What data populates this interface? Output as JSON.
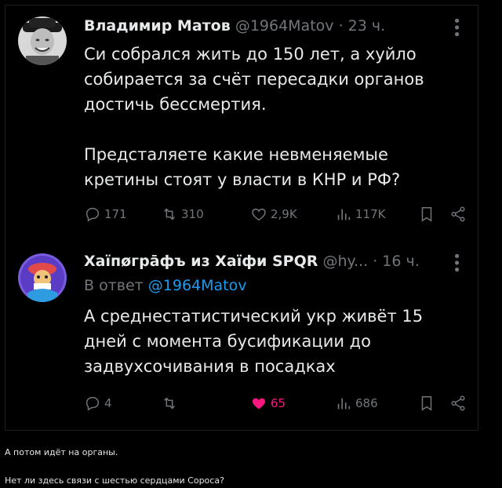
{
  "tweets": [
    {
      "author_name": "Владимир Матов",
      "handle": "@1964Matov",
      "separator": "·",
      "time": "23 ч.",
      "more_icon": "more-vertical-icon",
      "paragraphs": [
        "Си собрался жить до 150 лет, а хуйло собирается за счёт пересадки органов достичь бессмертия.",
        "Предсталяете какие невменяемые кретины стоят у власти в КНР и РФ?"
      ],
      "actions": {
        "replies": "171",
        "reposts": "310",
        "likes": "2,9K",
        "views": "117K"
      },
      "liked": false
    },
    {
      "author_name": "Хаїпøгрāфъ из Хаїфи SPQR",
      "handle": "@hy...",
      "separator": "·",
      "time": "16 ч.",
      "reply_prefix": "В ответ",
      "reply_handle": "@1964Matov",
      "paragraphs": [
        "А среднестатистический укр живёт 15 дней с момента бусификации до задвухсочивания в посадках"
      ],
      "actions": {
        "replies": "4",
        "reposts": "",
        "likes": "65",
        "views": "686"
      },
      "liked": true
    }
  ],
  "captions": [
    "А потом идёт на органы.",
    "Нет ли здесь связи с шестью сердцами Сороса?"
  ],
  "colors": {
    "background": "#000000",
    "text_primary": "#e7e9ea",
    "text_secondary": "#71767b",
    "link": "#1d9bf0",
    "like_active": "#f91880"
  }
}
